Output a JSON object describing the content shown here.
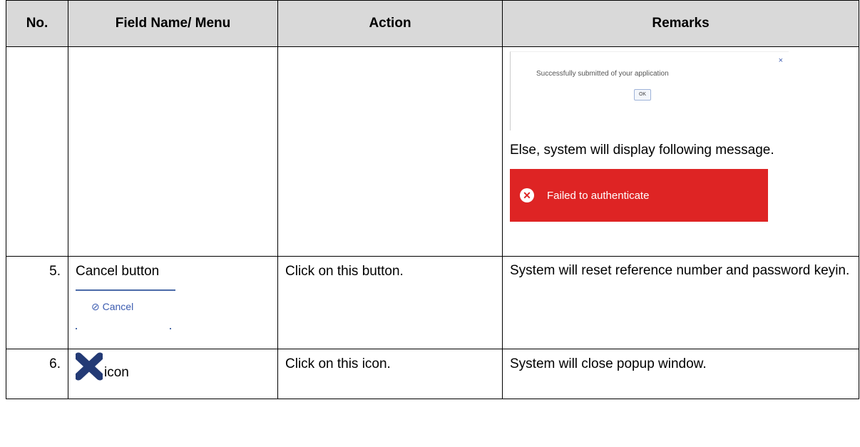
{
  "headers": {
    "no": "No.",
    "field": "Field Name/ Menu",
    "action": "Action",
    "remarks": "Remarks"
  },
  "row_cont": {
    "popup_close": "×",
    "popup_message": "Successfully submitted of your application",
    "popup_ok": "OK",
    "else_text": "Else, system will display following message.",
    "error_icon": "x-circle-icon",
    "error_text": "Failed to authenticate",
    "error_color": "#de2424"
  },
  "row5": {
    "no": "5.",
    "field": "Cancel button",
    "cancel_label": "⊘ Cancel",
    "action": "Click on this button.",
    "remarks": "System will reset reference number and password keyin."
  },
  "row6": {
    "no": "6.",
    "icon": "close-x-icon",
    "field_suffix": "icon",
    "action": "Click on this icon.",
    "remarks": "System will close popup window."
  }
}
